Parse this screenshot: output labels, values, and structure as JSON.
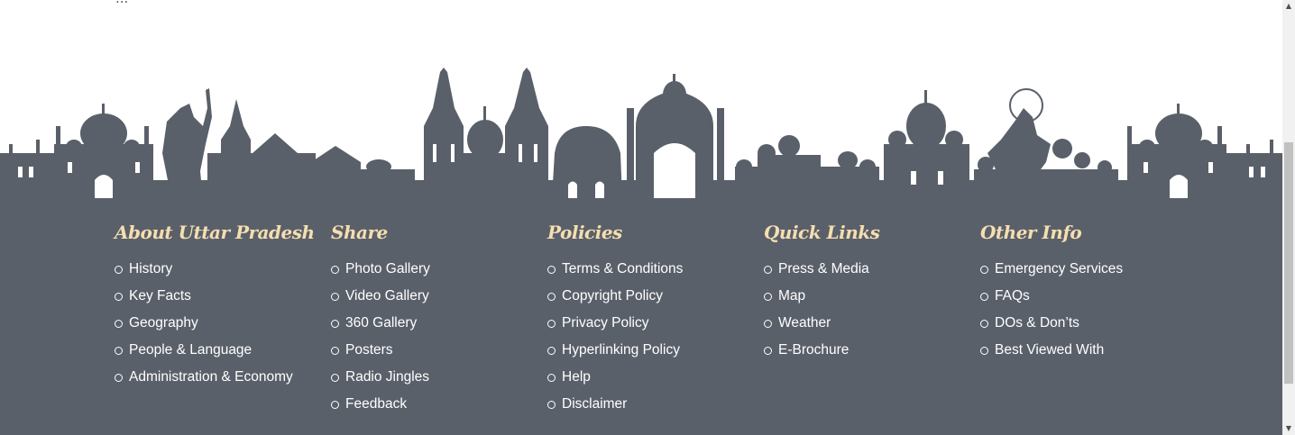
{
  "top_text": "...",
  "footer": {
    "columns": [
      {
        "title": "About Uttar Pradesh",
        "items": [
          "History",
          "Key Facts",
          "Geography",
          "People & Language",
          "Administration & Economy"
        ]
      },
      {
        "title": "Share",
        "items": [
          "Photo Gallery",
          "Video Gallery",
          "360 Gallery",
          "Posters",
          "Radio Jingles",
          "Feedback"
        ]
      },
      {
        "title": "Policies",
        "items": [
          "Terms & Conditions",
          "Copyright Policy",
          "Privacy Policy",
          "Hyperlinking Policy",
          "Help",
          "Disclaimer"
        ]
      },
      {
        "title": "Quick Links",
        "items": [
          "Press & Media",
          "Map",
          "Weather",
          "E-Brochure"
        ]
      },
      {
        "title": "Other Info",
        "items": [
          "Emergency Services",
          "FAQs",
          "DOs & Don’ts",
          "Best Viewed With"
        ]
      }
    ]
  },
  "colors": {
    "footer_bg": "#5a606a",
    "title_color": "#f5deb0",
    "link_color": "#ffffff"
  },
  "scrollbar": {
    "position_fraction": 0.62
  }
}
